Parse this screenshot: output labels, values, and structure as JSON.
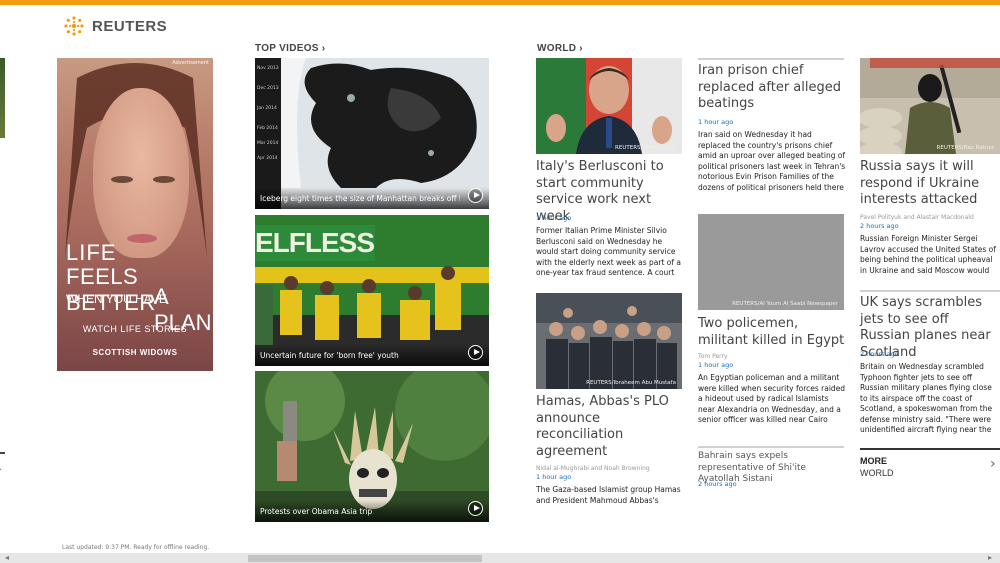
{
  "app": {
    "brand": "REUTERS",
    "status": "Last updated: 9:37 PM. Ready for offline reading."
  },
  "sections": {
    "top_videos": "TOP VIDEOS",
    "world": "WORLD"
  },
  "ad": {
    "label": "Advertisement",
    "line1": "LIFE",
    "line2": "FEELS BETTER",
    "line3": "WHEN YOU HAVE",
    "line4": "A PLAN",
    "cta": "WATCH LIFE STORIES",
    "brand": "SCOTTISH WIDOWS"
  },
  "videos": [
    {
      "caption": "Iceberg eight times the size of Manhattan breaks off from...",
      "dates": [
        "Nov 2013",
        "Dec 2013",
        "Jan 2014",
        "Feb 2014",
        "Mar 2014",
        "Apr 2014"
      ]
    },
    {
      "caption": "Uncertain future for 'born free' youth",
      "banner": "ELFLESS"
    },
    {
      "caption": "Protests over Obama Asia trip"
    }
  ],
  "world": {
    "a1": {
      "credit": "REUTERS/Remo Casilli",
      "headline": "Italy's Berlusconi to start community service work next week",
      "time": "1 hour ago",
      "body": "Former Italian Prime Minister Silvio Berlusconi said on Wednesday he would start doing community service with the elderly next week as part of a one-year tax fraud sentence. A court ruled earlier"
    },
    "a2": {
      "credit": "REUTERS/Ibraheem Abu Mustafa",
      "headline": "Hamas, Abbas's PLO announce reconciliation agreement",
      "byline": "Nidal al-Mughrabi and Noah Browning",
      "time": "1 hour ago",
      "body": "The Gaza-based Islamist group Hamas and President Mahmoud Abbas's"
    },
    "a3": {
      "headline": "Iran prison chief replaced after alleged beatings",
      "time": "1 hour ago",
      "body": "Iran said on Wednesday it had replaced the country's prisons chief amid an uproar over alleged beating of political prisoners last week in Tehran's notorious Evin Prison Families of the dozens of political prisoners held there have been"
    },
    "a4": {
      "credit": "REUTERS/Al Youm Al Saabi Newspaper",
      "headline": "Two policemen, militant killed in Egypt",
      "byline": "Tom Perry",
      "time": "1 hour ago",
      "body": "An Egyptian policeman and a militant were killed when security forces raided a hideout used by radical Islamists near Alexandria on Wednesday, and a senior officer was killed near Cairo when a"
    },
    "a5": {
      "headline": "Bahrain says expels representative of Shi'ite Ayatollah Sistani",
      "time": "2 hours ago"
    },
    "a6": {
      "credit": "REUTERS/Baz Ratner",
      "headline": "Russia says it will respond if Ukraine interests attacked",
      "byline": "Pavel Polityuk and Alastair Macdonald",
      "time": "2 hours ago",
      "body": "Russian Foreign Minister Sergei Lavrov accused the United States of being behind the political upheaval in Ukraine and said Moscow would respond if its"
    },
    "a7": {
      "headline": "UK says scrambles jets to see off Russian planes near Scotland",
      "time": "2 hours ago",
      "body": "Britain on Wednesday scrambled Typhoon fighter jets to see off Russian military planes flying close to its airspace off the coast of Scotland, a spokeswoman from the defense ministry said. \"There were unidentified aircraft flying near the north of Scotland,\" the"
    },
    "more": "MORE",
    "more_sub": "WORLD"
  },
  "colors": {
    "accent": "#f39c12",
    "link_time": "#1a6fb5"
  }
}
